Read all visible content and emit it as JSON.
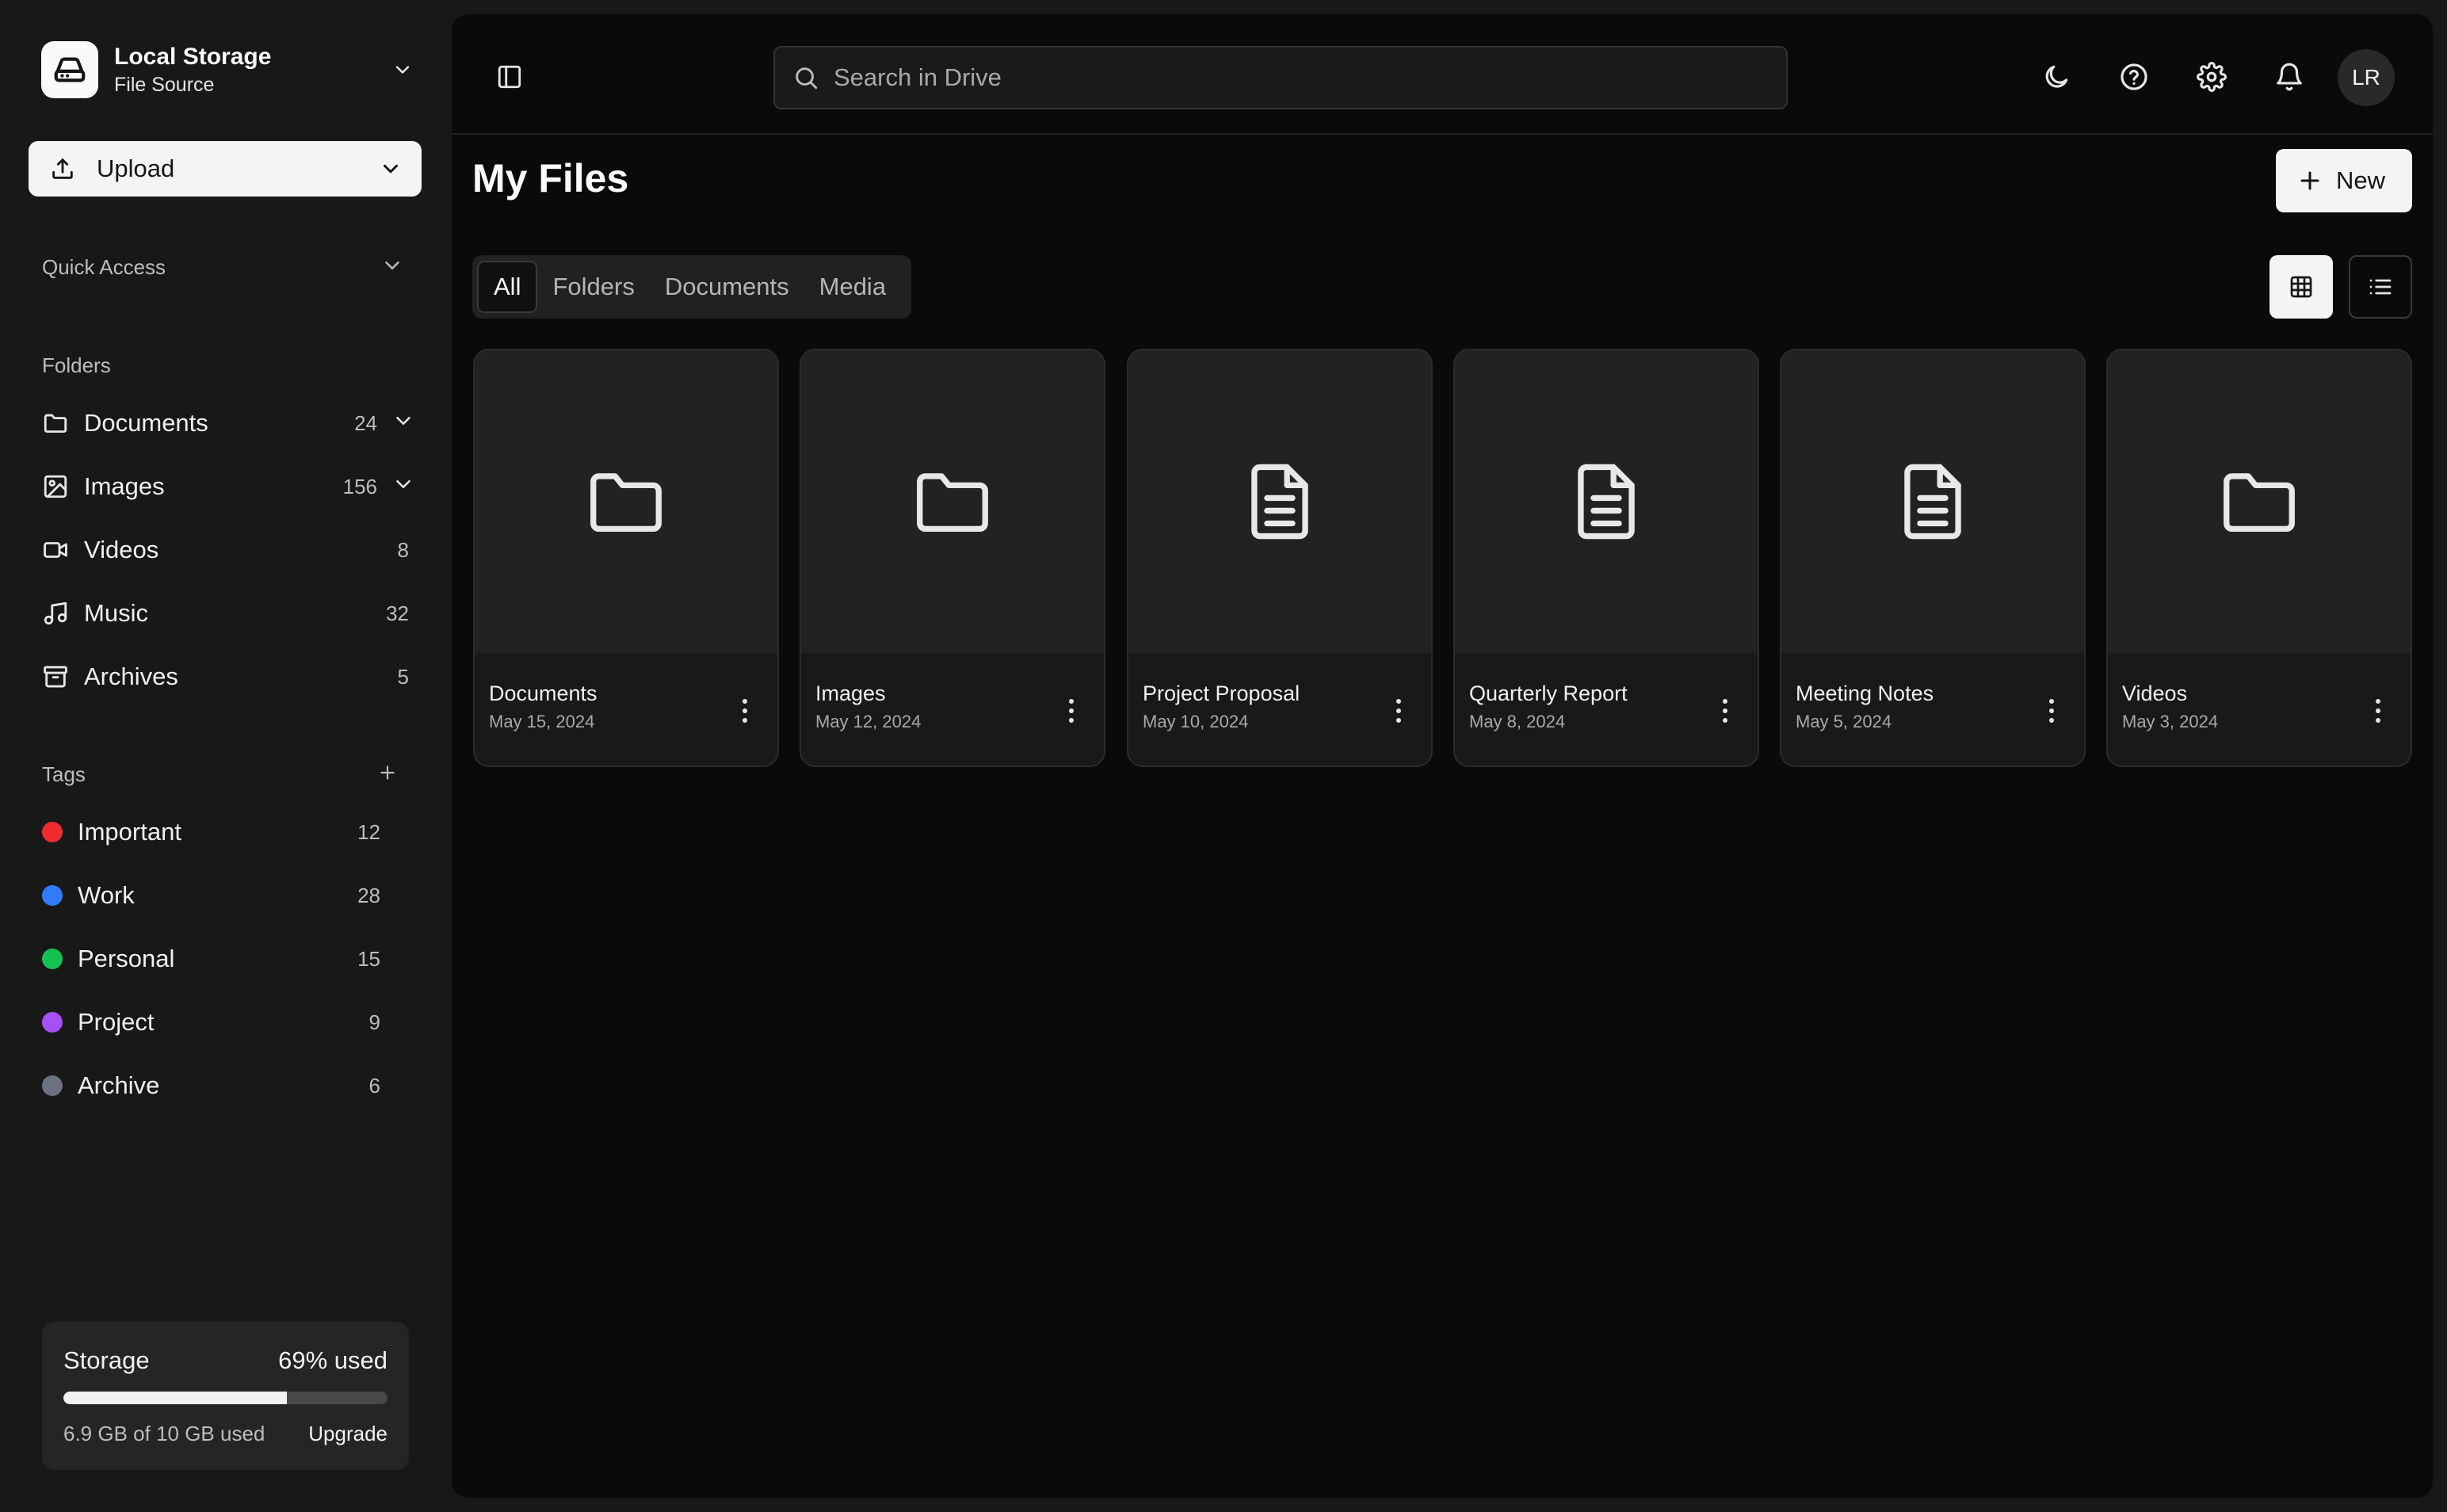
{
  "source": {
    "title": "Local Storage",
    "subtitle": "File Source"
  },
  "upload": {
    "label": "Upload"
  },
  "quick_access": {
    "label": "Quick Access"
  },
  "folders": {
    "label": "Folders",
    "items": [
      {
        "label": "Documents",
        "count": "24",
        "icon": "folder-icon"
      },
      {
        "label": "Images",
        "count": "156",
        "icon": "image-icon"
      },
      {
        "label": "Videos",
        "count": "8",
        "icon": "video-icon"
      },
      {
        "label": "Music",
        "count": "32",
        "icon": "music-icon"
      },
      {
        "label": "Archives",
        "count": "5",
        "icon": "archive-icon"
      }
    ]
  },
  "tags": {
    "label": "Tags",
    "items": [
      {
        "label": "Important",
        "count": "12",
        "color": "#ef2b2d"
      },
      {
        "label": "Work",
        "count": "28",
        "color": "#2f7cf6"
      },
      {
        "label": "Personal",
        "count": "15",
        "color": "#16c154"
      },
      {
        "label": "Project",
        "count": "9",
        "color": "#a650f5"
      },
      {
        "label": "Archive",
        "count": "6",
        "color": "#6b7180"
      }
    ]
  },
  "storage": {
    "title": "Storage",
    "used_label": "69% used",
    "used_fraction": 0.69,
    "detail": "6.9 GB of 10 GB used",
    "upgrade_label": "Upgrade"
  },
  "search": {
    "placeholder": "Search in Drive"
  },
  "header_icons": [
    "moon-icon",
    "help-icon",
    "settings-icon",
    "bell-icon"
  ],
  "avatar": {
    "initials": "LR"
  },
  "page": {
    "title": "My Files",
    "new_label": "New"
  },
  "filters": [
    "All",
    "Folders",
    "Documents",
    "Media"
  ],
  "active_filter": "All",
  "files": [
    {
      "name": "Documents",
      "date": "May 15, 2024",
      "kind": "folder"
    },
    {
      "name": "Images",
      "date": "May 12, 2024",
      "kind": "folder"
    },
    {
      "name": "Project Proposal",
      "date": "May 10, 2024",
      "kind": "document"
    },
    {
      "name": "Quarterly Report",
      "date": "May 8, 2024",
      "kind": "document"
    },
    {
      "name": "Meeting Notes",
      "date": "May 5, 2024",
      "kind": "document"
    },
    {
      "name": "Videos",
      "date": "May 3, 2024",
      "kind": "folder"
    }
  ]
}
